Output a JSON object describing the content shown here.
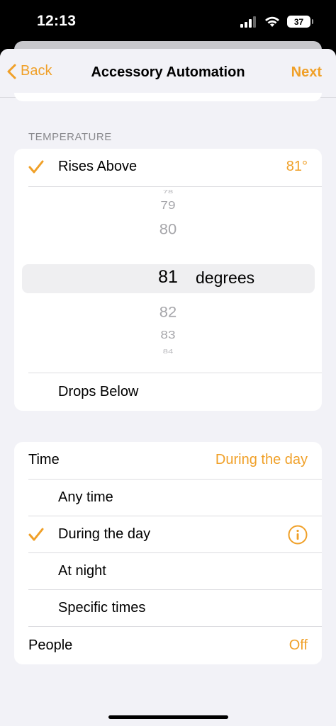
{
  "status": {
    "time": "12:13",
    "battery": "37"
  },
  "nav": {
    "back": "Back",
    "title": "Accessory Automation",
    "next": "Next"
  },
  "temperature": {
    "section_label": "TEMPERATURE",
    "rises_above_label": "Rises Above",
    "rises_above_value": "81°",
    "picker_values": [
      "78",
      "79",
      "80",
      "81",
      "82",
      "83",
      "84"
    ],
    "picker_selected": "81",
    "picker_unit": "degrees",
    "drops_below_label": "Drops Below"
  },
  "time_section": {
    "label": "Time",
    "value": "During the day",
    "options": [
      "Any time",
      "During the day",
      "At night",
      "Specific times"
    ]
  },
  "people": {
    "label": "People",
    "value": "Off"
  },
  "colors": {
    "accent": "#f0a028",
    "background": "#f2f2f7"
  }
}
